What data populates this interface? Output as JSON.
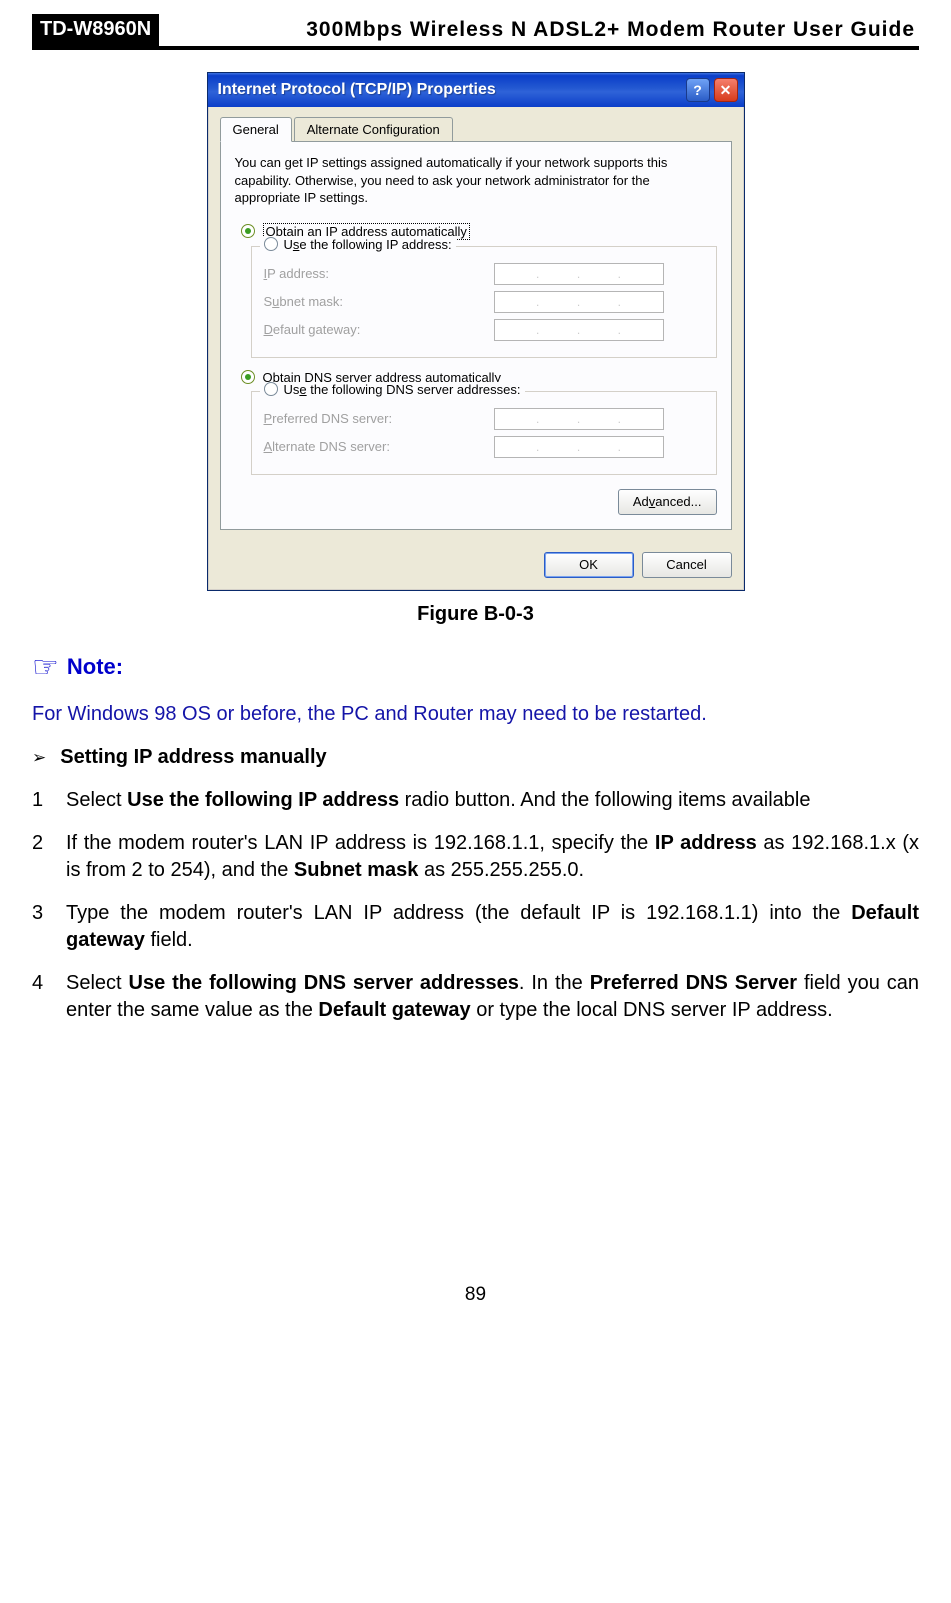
{
  "header": {
    "model": "TD-W8960N",
    "title": "300Mbps Wireless N ADSL2+ Modem Router User Guide"
  },
  "dialog": {
    "title": "Internet Protocol (TCP/IP) Properties",
    "help_symbol": "?",
    "close_symbol": "✕",
    "tabs": {
      "general": "General",
      "alt": "Alternate Configuration"
    },
    "intro": "You can get IP settings assigned automatically if your network supports this capability. Otherwise, you need to ask your network administrator for the appropriate IP settings.",
    "ip": {
      "auto_prefix": "O",
      "auto_label": "btain an IP address automatically",
      "manual_label_pre": "U",
      "manual_underline": "s",
      "manual_label_post": "e the following IP address:",
      "field_ip_pre": "",
      "field_ip_u": "I",
      "field_ip_post": "P address:",
      "field_sn_pre": "S",
      "field_sn_u": "u",
      "field_sn_post": "bnet mask:",
      "field_gw_pre": "",
      "field_gw_u": "D",
      "field_gw_post": "efault gateway:"
    },
    "dns": {
      "auto_pre": "O",
      "auto_u": "b",
      "auto_post": "tain DNS server address automatically",
      "manual_pre": "Us",
      "manual_u": "e",
      "manual_post": " the following DNS server addresses:",
      "pref_pre": "",
      "pref_u": "P",
      "pref_post": "referred DNS server:",
      "alt_pre": "",
      "alt_u": "A",
      "alt_post": "lternate DNS server:"
    },
    "advanced_pre": "Ad",
    "advanced_u": "v",
    "advanced_post": "anced...",
    "ok": "OK",
    "cancel": "Cancel",
    "dot": "."
  },
  "figure_caption": "Figure B-0-3",
  "note_icon": "☞",
  "note_label": "Note:",
  "note_text": "For Windows 98 OS or before, the PC and Router may need to be restarted.",
  "chevron": "➢",
  "section_title": "Setting IP address manually",
  "steps": {
    "s1": {
      "n": "1",
      "pre": "Select ",
      "b1": "Use the following IP address",
      "post": " radio button. And the following items available"
    },
    "s2": {
      "n": "2",
      "pre": "If the modem router's LAN IP address is 192.168.1.1, specify the ",
      "b1": "IP address",
      "mid": " as 192.168.1.x (x is from 2 to 254), and the ",
      "b2": "Subnet mask",
      "post": " as 255.255.255.0."
    },
    "s3": {
      "n": "3",
      "pre": "Type the modem router's LAN IP address (the default IP is 192.168.1.1) into the ",
      "b1": "Default gateway",
      "post": " field."
    },
    "s4": {
      "n": "4",
      "pre": "Select ",
      "b1": "Use the following DNS server addresses",
      "mid": ". In the ",
      "b2": "Preferred DNS Server",
      "mid2": " field you can enter the same value as the ",
      "b3": "Default gateway",
      "post": " or type the local DNS server IP address."
    }
  },
  "page_number": "89"
}
